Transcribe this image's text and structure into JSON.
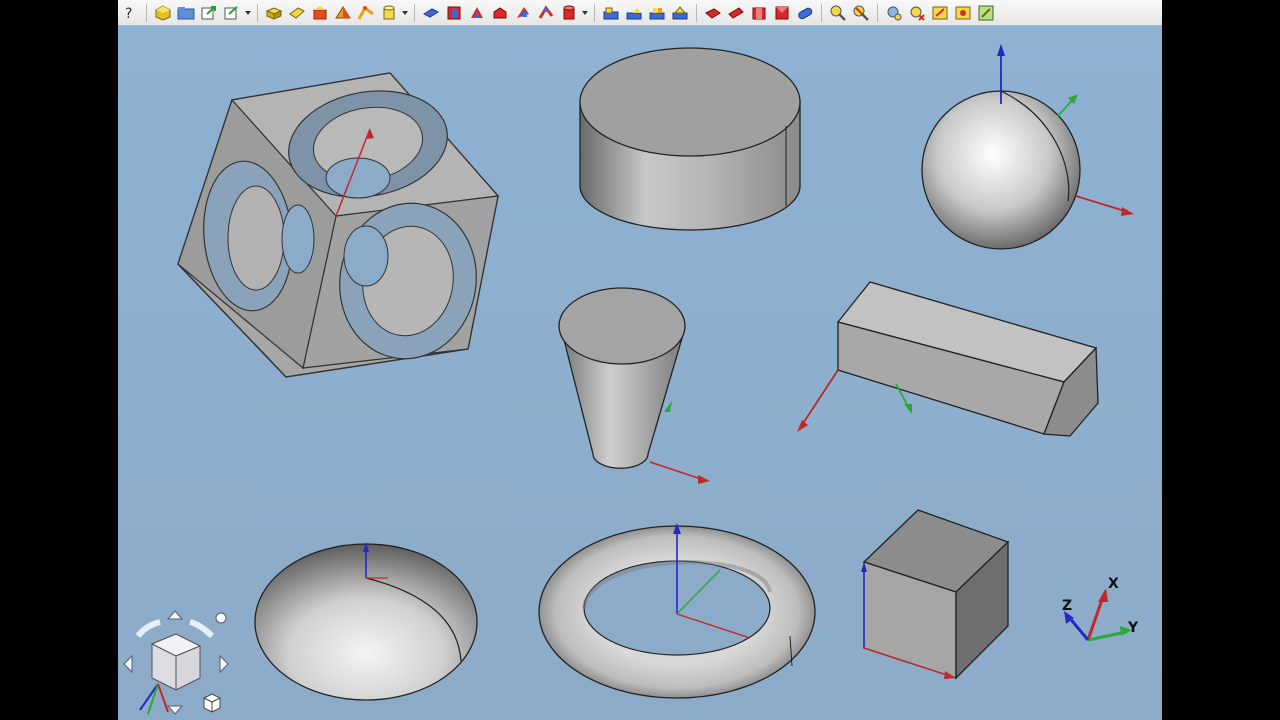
{
  "toolbar": {
    "groups": [
      {
        "name": "file",
        "icons": [
          "help-whatsthis-icon",
          "part-design-icon",
          "open-folder-icon",
          "export-icon",
          "macro-icon"
        ]
      },
      {
        "name": "primitives",
        "icons": [
          "cube-primitive-icon",
          "extrude-icon",
          "revolve-icon",
          "mirror-icon",
          "fillet-icon",
          "cylinder-primitive-icon"
        ]
      },
      {
        "name": "boolean",
        "icons": [
          "boolean-icon",
          "cut-icon",
          "fuse-icon",
          "common-icon",
          "section-icon",
          "cross-section-icon"
        ]
      },
      {
        "name": "shapes",
        "icons": [
          "chamfer-icon",
          "offset-icon",
          "thickness-icon",
          "make-face-icon"
        ]
      },
      {
        "name": "solids",
        "icons": [
          "box-solid-icon",
          "wedge-icon",
          "prism-icon",
          "pipe-icon",
          "sweep-icon"
        ]
      },
      {
        "name": "measure",
        "icons": [
          "measure-linear-icon",
          "measure-angular-icon",
          "refine-icon",
          "check-geometry-icon",
          "clear-measure-icon",
          "toggle-measure-icon",
          "sketch-icon"
        ]
      }
    ]
  },
  "axes": {
    "x_label": "X",
    "y_label": "Y",
    "z_label": "Z"
  },
  "colors": {
    "viewport_top": "#8fb1d2",
    "viewport_bottom": "#8cabc8",
    "shape_gray": "#a8a8a8",
    "axis_x": "#c0282a",
    "axis_y": "#2aa838",
    "axis_z": "#2528c4"
  },
  "shapes": [
    "cut-cube",
    "cylinder",
    "sphere",
    "cone",
    "prism",
    "ellipsoid",
    "torus",
    "box"
  ]
}
